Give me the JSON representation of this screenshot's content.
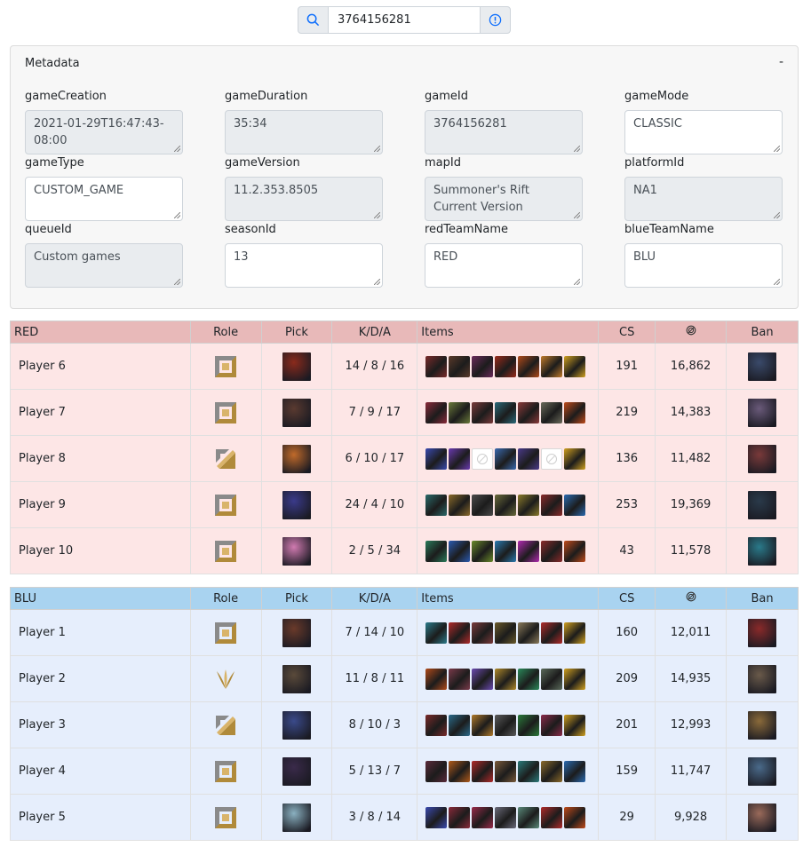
{
  "search": {
    "value": "3764156281"
  },
  "metadata": {
    "title": "Metadata",
    "collapse_label": "-",
    "fields": [
      {
        "label": "gameCreation",
        "value": "2021-01-29T16:47:43-08:00",
        "readonly": true
      },
      {
        "label": "gameDuration",
        "value": "35:34",
        "readonly": true
      },
      {
        "label": "gameId",
        "value": "3764156281",
        "readonly": true
      },
      {
        "label": "gameMode",
        "value": "CLASSIC",
        "readonly": false
      },
      {
        "label": "gameType",
        "value": "CUSTOM_GAME",
        "readonly": false
      },
      {
        "label": "gameVersion",
        "value": "11.2.353.8505",
        "readonly": true
      },
      {
        "label": "mapId",
        "value": "Summoner's Rift Current Version",
        "readonly": true
      },
      {
        "label": "platformId",
        "value": "NA1",
        "readonly": true
      },
      {
        "label": "queueId",
        "value": "Custom games",
        "readonly": true
      },
      {
        "label": "seasonId",
        "value": "13",
        "readonly": false
      },
      {
        "label": "redTeamName",
        "value": "RED",
        "readonly": false
      },
      {
        "label": "blueTeamName",
        "value": "BLU",
        "readonly": false
      }
    ]
  },
  "columns": {
    "role": "Role",
    "pick": "Pick",
    "kda": "K/D/A",
    "items": "Items",
    "cs": "CS",
    "gold_icon": "gold-icon",
    "ban": "Ban"
  },
  "colors": {
    "red_header": "#e8b9b9",
    "red_row": "#fde6e6",
    "blue_header": "#a9d3f0",
    "blue_row": "#e6eefc"
  },
  "red": {
    "name": "RED",
    "players": [
      {
        "name": "Player 6",
        "role": "square-role-icon",
        "pick": "#8a2a1c",
        "kda": "14 / 8 / 16",
        "items": [
          "#7a2a2a",
          "#5a3a2a",
          "#6a2a5a",
          "#9a2a1a",
          "#b04a1a",
          "#c07a2a",
          "#d0a020"
        ],
        "cs": "191",
        "gold": "16,862",
        "ban": "#3a4a6a"
      },
      {
        "name": "Player 7",
        "role": "square-role-icon",
        "pick": "#5a3a30",
        "kda": "7 / 9 / 17",
        "items": [
          "#8a2a3a",
          "#6a7a3a",
          "#7a3a3a",
          "#2a6a7a",
          "#8a3a3a",
          "#6a6a5a",
          "#c04a1a"
        ],
        "cs": "219",
        "gold": "14,383",
        "ban": "#6a5a7a"
      },
      {
        "name": "Player 8",
        "role": "diagonal-role-icon",
        "pick": "#c06a2a",
        "kda": "6 / 10 / 17",
        "items": [
          "#3a4ab0",
          "#6a3ab0",
          "empty",
          "#3a6ab0",
          "#4a3a8a",
          "empty",
          "#d0a020"
        ],
        "cs": "136",
        "gold": "11,482",
        "ban": "#7a3a3a"
      },
      {
        "name": "Player 9",
        "role": "square-role-icon",
        "pick": "#3a3a8a",
        "kda": "24 / 4 / 10",
        "items": [
          "#2a6a6a",
          "#8a6a2a",
          "#4a4a4a",
          "#6a6a3a",
          "#8a7a2a",
          "#8a2a2a",
          "#2a6ab0"
        ],
        "cs": "253",
        "gold": "19,369",
        "ban": "#2a3a4a"
      },
      {
        "name": "Player 10",
        "role": "square-role-icon",
        "pick": "#d07ab0",
        "kda": "2 / 5 / 34",
        "items": [
          "#2a7a5a",
          "#2a5ab0",
          "#6a8a2a",
          "#2a7ab0",
          "#b02ab0",
          "#8a2a2a",
          "#c04a1a"
        ],
        "cs": "43",
        "gold": "11,578",
        "ban": "#2a7a8a"
      }
    ]
  },
  "blue": {
    "name": "BLU",
    "players": [
      {
        "name": "Player 1",
        "role": "square-role-icon",
        "pick": "#6a3a2a",
        "kda": "7 / 14 / 10",
        "items": [
          "#2a7a8a",
          "#b02a2a",
          "#7a3a3a",
          "#6a5a2a",
          "#8a7a5a",
          "#b02a2a",
          "#d0a020"
        ],
        "cs": "160",
        "gold": "12,011",
        "ban": "#8a2a2a"
      },
      {
        "name": "Player 2",
        "role": "jungle-role-icon",
        "pick": "#5a4a3a",
        "kda": "11 / 8 / 11",
        "items": [
          "#b04a1a",
          "#7a3a4a",
          "#6a4ab0",
          "#b08a2a",
          "#2a8a5a",
          "#5a6a5a",
          "#d0a020"
        ],
        "cs": "209",
        "gold": "14,935",
        "ban": "#6a5a4a"
      },
      {
        "name": "Player 3",
        "role": "diagonal-role-icon",
        "pick": "#3a4a8a",
        "kda": "8 / 10 / 3",
        "items": [
          "#7a2a2a",
          "#2a6a8a",
          "#b07a2a",
          "#5a5a5a",
          "#2a7a3a",
          "#8a2a4a",
          "#d0a020"
        ],
        "cs": "201",
        "gold": "12,993",
        "ban": "#8a6a3a"
      },
      {
        "name": "Player 4",
        "role": "square-role-icon",
        "pick": "#3a2a4a",
        "kda": "5 / 13 / 7",
        "items": [
          "#5a2a3a",
          "#b05a1a",
          "#b02a2a",
          "#7a5a3a",
          "#2a7a7a",
          "#8a6a2a",
          "#2a6ab0"
        ],
        "cs": "159",
        "gold": "11,747",
        "ban": "#4a6a8a"
      },
      {
        "name": "Player 5",
        "role": "square-role-icon",
        "pick": "#8ab0c0",
        "kda": "3 / 8 / 14",
        "items": [
          "#3a4ab0",
          "#8a2a3a",
          "#9a2a4a",
          "#6a6a7a",
          "#5a8a7a",
          "#b02a2a",
          "#c04a1a"
        ],
        "cs": "29",
        "gold": "9,928",
        "ban": "#9a6a5a"
      }
    ]
  }
}
